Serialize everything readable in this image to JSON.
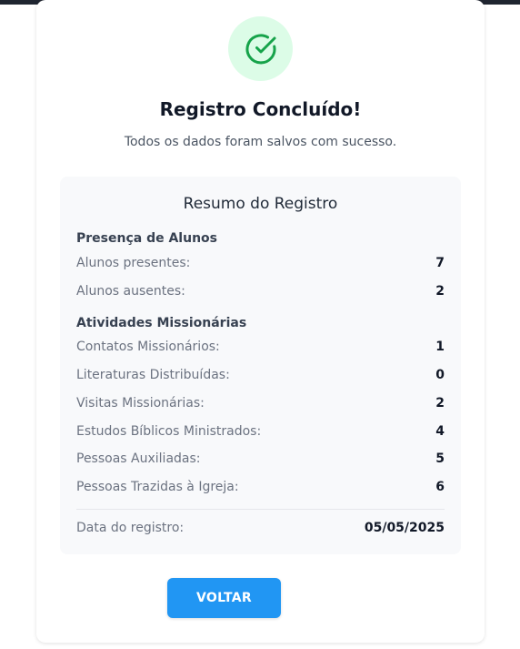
{
  "header": {
    "title": "Registro Concluído!",
    "subtitle": "Todos os dados foram salvos com sucesso."
  },
  "summary": {
    "title": "Resumo do Registro",
    "attendance": {
      "title": "Presença de Alunos",
      "rows": [
        {
          "label": "Alunos presentes:",
          "value": "7"
        },
        {
          "label": "Alunos ausentes:",
          "value": "2"
        }
      ]
    },
    "missionary": {
      "title": "Atividades Missionárias",
      "rows": [
        {
          "label": "Contatos Missionários:",
          "value": "1"
        },
        {
          "label": "Literaturas Distribuídas:",
          "value": "0"
        },
        {
          "label": "Visitas Missionárias:",
          "value": "2"
        },
        {
          "label": "Estudos Bíblicos Ministrados:",
          "value": "4"
        },
        {
          "label": "Pessoas Auxiliadas:",
          "value": "5"
        },
        {
          "label": "Pessoas Trazidas à Igreja:",
          "value": "6"
        }
      ]
    },
    "date": {
      "label": "Data do registro:",
      "value": "05/05/2025"
    }
  },
  "actions": {
    "back_label": "VOLTAR"
  },
  "colors": {
    "success": "#16a34a",
    "success_bg": "#dcfce7",
    "primary": "#2196f3"
  },
  "icons": {
    "status": "check-circle-icon"
  }
}
